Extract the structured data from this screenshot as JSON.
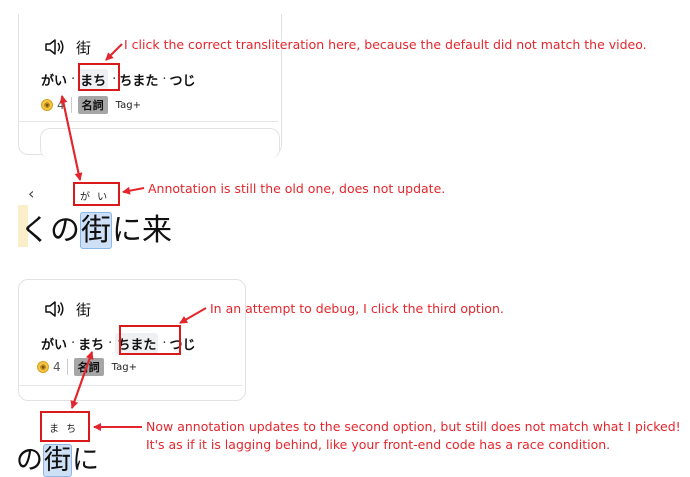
{
  "colors": {
    "annotation_red": "#e3262d",
    "tag_gray": "#a6a6a6",
    "highlight_blue": "#cde0f6"
  },
  "panel1": {
    "word": "街",
    "readings": [
      "がい",
      "まち",
      "ちまた",
      "つじ"
    ],
    "dot": "·",
    "count": "4",
    "tag": "名詞",
    "tag_add": "Tag+"
  },
  "note1": "I click the correct transliteration here, because the default did not match the video.",
  "subtitle1": {
    "nav_arrow": "‹",
    "furigana": "が い",
    "text_before": "くの",
    "target": "街",
    "text_after": "に来"
  },
  "note2": "Annotation is still the old one, does not update.",
  "panel2": {
    "word": "街",
    "readings": [
      "がい",
      "まち",
      "ちまた",
      "つじ"
    ],
    "dot": "·",
    "count": "4",
    "tag": "名詞",
    "tag_add": "Tag+"
  },
  "note3": "In an attempt to debug, I click the third option.",
  "subtitle2": {
    "furigana": "ま ち",
    "text_before": "の",
    "target": "街",
    "text_after": "に"
  },
  "note4": {
    "line1": "Now annotation updates to the second option, but still does not match what I picked!",
    "line2": "It's as if it is lagging behind, like your front-end code has a race condition."
  }
}
